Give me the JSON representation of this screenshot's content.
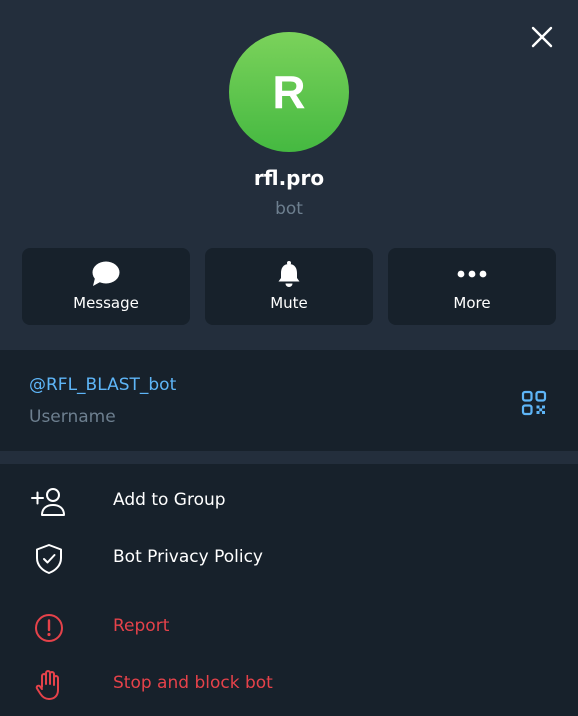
{
  "profile": {
    "avatar_letter": "R",
    "name": "rfl.pro",
    "type": "bot"
  },
  "actions": {
    "message_label": "Message",
    "mute_label": "Mute",
    "more_label": "More"
  },
  "info": {
    "username_value": "@RFL_BLAST_bot",
    "username_label": "Username"
  },
  "menu": {
    "add_to_group": "Add to Group",
    "privacy_policy": "Bot Privacy Policy",
    "report": "Report",
    "stop_block": "Stop and block bot"
  },
  "colors": {
    "header_bg": "#232e3c",
    "panel_bg": "#17212b",
    "accent_blue": "#5eb5f7",
    "danger_red": "#e5424a",
    "avatar_green": "#45b941"
  },
  "icons": {
    "close": "close-icon",
    "message": "chat-bubble-icon",
    "mute": "bell-icon",
    "more": "dots-icon",
    "qr": "qr-code-icon",
    "add_to_group": "add-user-icon",
    "privacy": "shield-check-icon",
    "report": "alert-circle-icon",
    "block": "hand-stop-icon"
  }
}
